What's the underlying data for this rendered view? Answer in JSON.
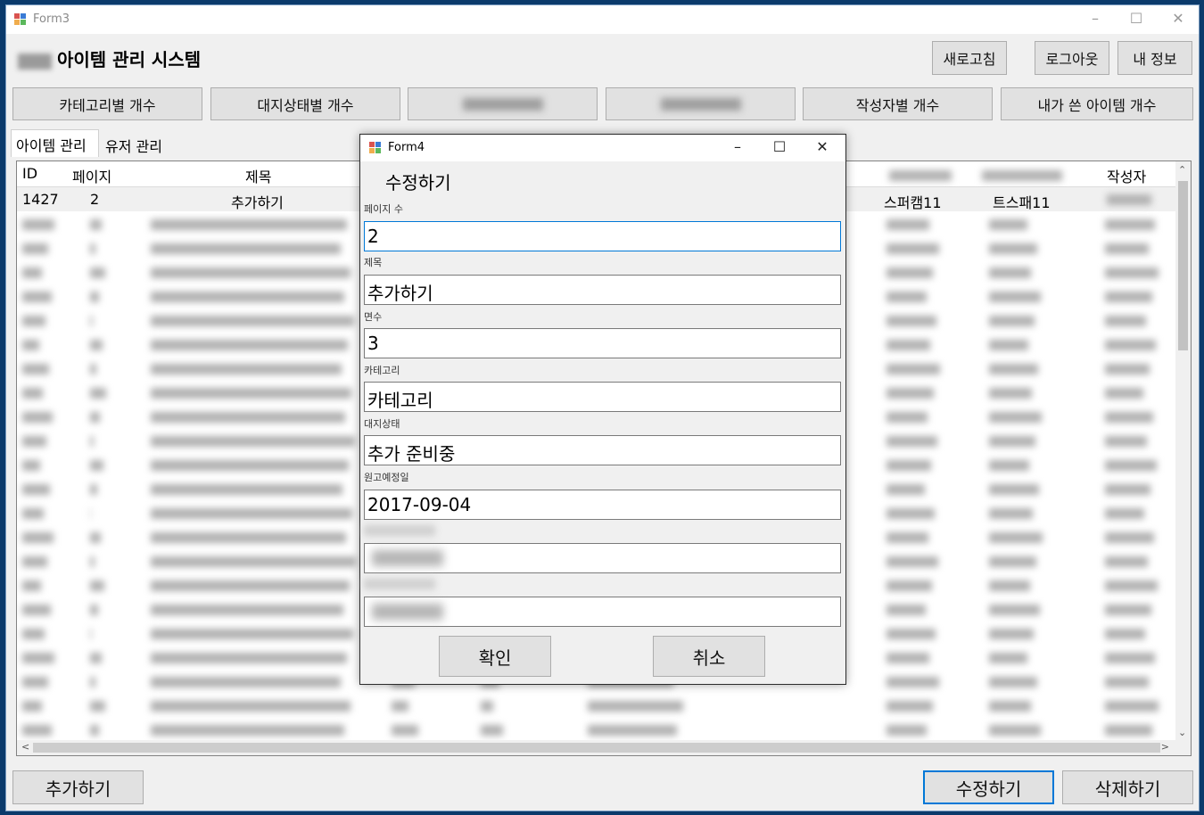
{
  "window": {
    "title": "Form3"
  },
  "header": {
    "title": "아이템 관리 시스템"
  },
  "top_buttons": {
    "refresh": "새로고침",
    "logout": "로그아웃",
    "my_info": "내 정보"
  },
  "category_buttons": [
    "카테고리별 개수",
    "대지상태별 개수",
    "작성자별 개수",
    "내가 쓴 아이템 개수"
  ],
  "tabs": [
    "아이템 관리",
    "유저 관리"
  ],
  "grid": {
    "headers": {
      "id": "ID",
      "page": "페이지",
      "title": "제목",
      "author": "작성자"
    },
    "selected_row": {
      "id": "1427",
      "page": "2",
      "title": "추가하기",
      "col_a": "스퍼캠11",
      "col_b": "트스패11"
    }
  },
  "bottom_buttons": {
    "add": "추가하기",
    "edit": "수정하기",
    "delete": "삭제하기"
  },
  "dialog": {
    "title": "Form4",
    "heading": "수정하기",
    "fields": [
      {
        "label": "페이지 수",
        "value": "2"
      },
      {
        "label": "제목",
        "value": "추가하기"
      },
      {
        "label": "면수",
        "value": "3"
      },
      {
        "label": "카테고리",
        "value": "카테고리"
      },
      {
        "label": "대지상태",
        "value": "추가 준비중"
      },
      {
        "label": "원고예정일",
        "value": "2017-09-04"
      }
    ],
    "confirm": "확인",
    "cancel": "취소"
  }
}
